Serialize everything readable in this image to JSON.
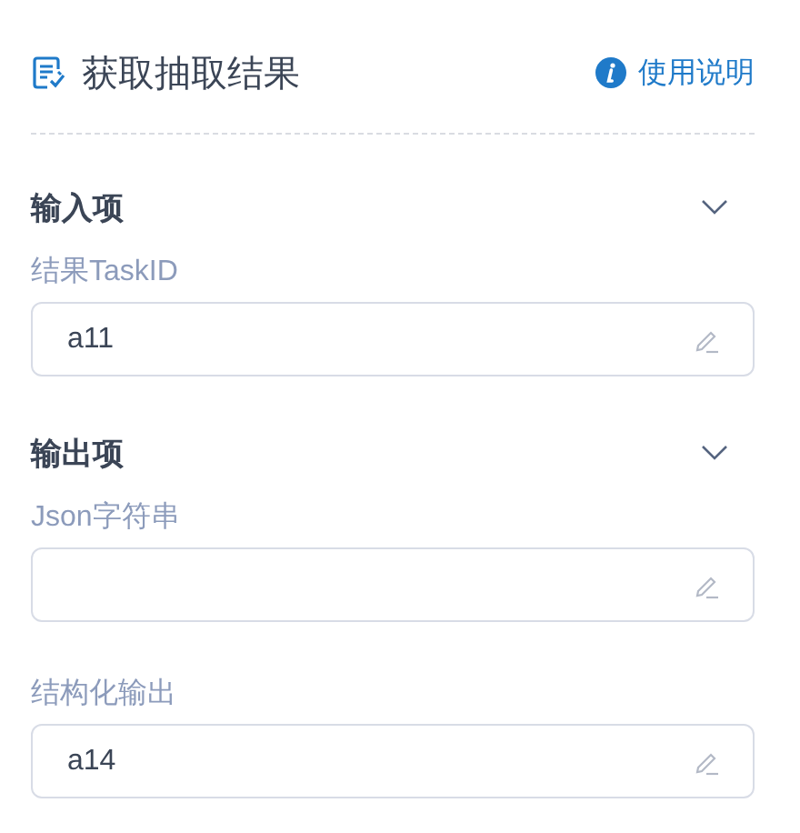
{
  "header": {
    "title": "获取抽取结果",
    "help_link": "使用说明"
  },
  "sections": [
    {
      "title": "输入项",
      "expanded": true,
      "fields": [
        {
          "label": "结果TaskID",
          "value": "a11"
        }
      ]
    },
    {
      "title": "输出项",
      "expanded": true,
      "fields": [
        {
          "label": "Json字符串"
        },
        {
          "label": "结构化输出",
          "value": "a14"
        }
      ]
    }
  ]
}
